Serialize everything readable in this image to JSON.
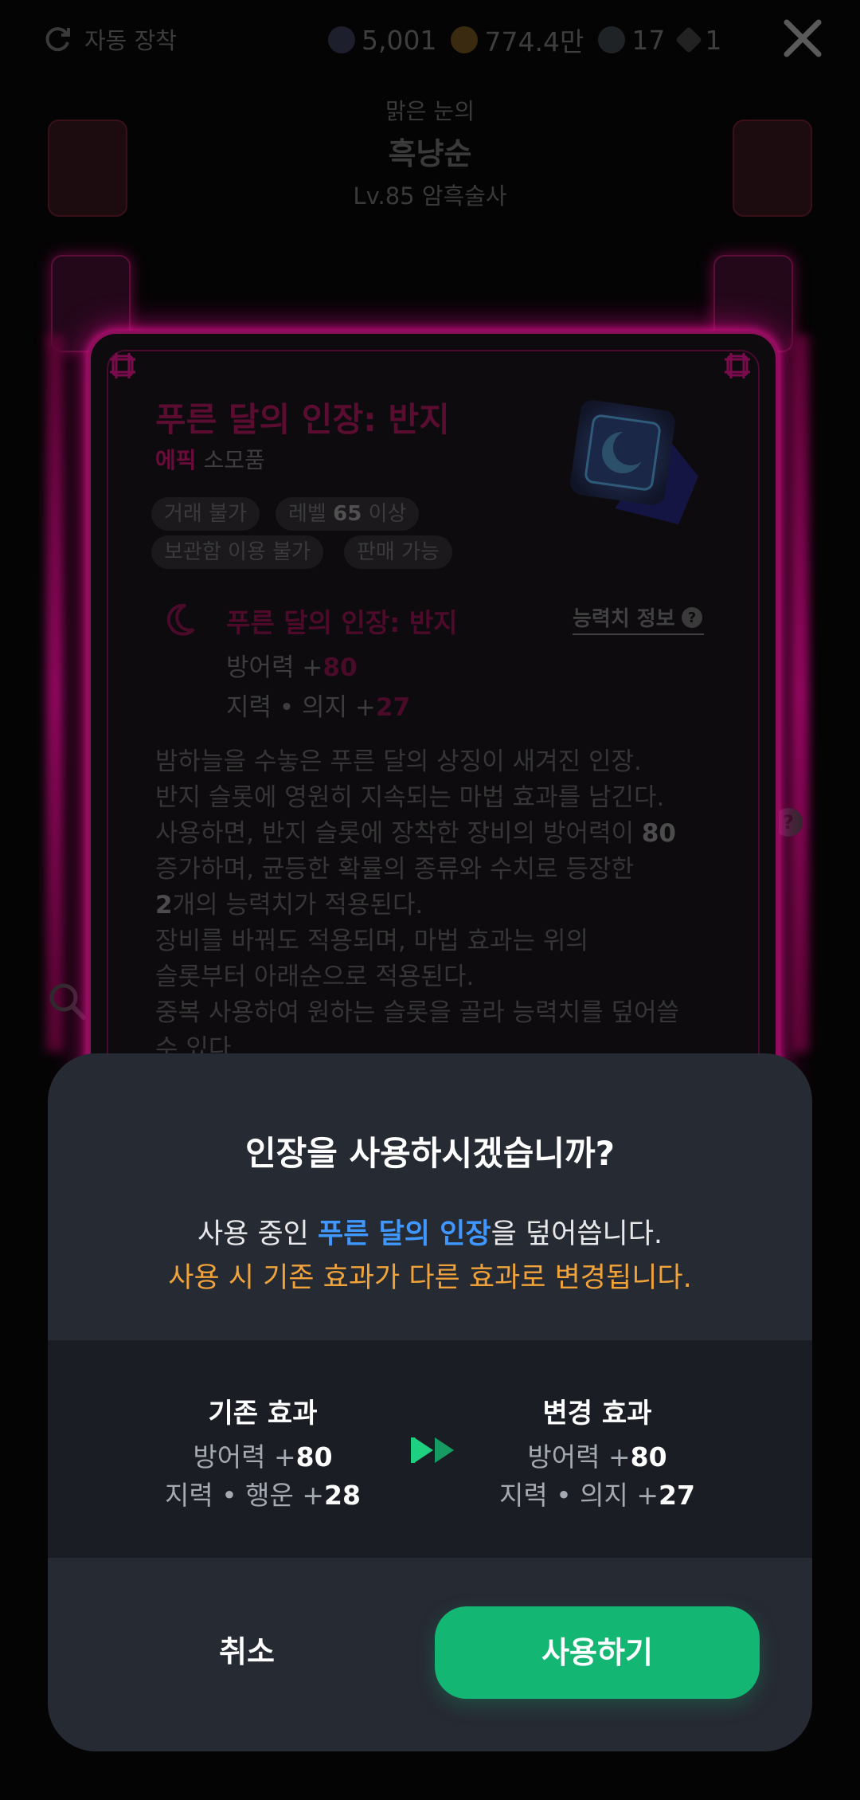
{
  "topbar": {
    "auto_equip_label": "자동 장착",
    "currencies": [
      {
        "icon": "dark-gem-icon",
        "value": "5,001"
      },
      {
        "icon": "gold-coin-icon",
        "value": "774.4만"
      },
      {
        "icon": "crystal-icon",
        "value": "17"
      },
      {
        "icon": "diamond-icon",
        "value": "1"
      }
    ]
  },
  "character": {
    "epithet": "맑은 눈의",
    "name": "흑냥순",
    "level_class": "Lv.85 암흑술사"
  },
  "item": {
    "name": "푸른 달의 인장: 반지",
    "grade": "에픽",
    "category": "소모품",
    "tags": [
      "거래 불가",
      "보관함 이용 불가",
      "판매 가능"
    ],
    "level_tag_prefix": "레벨",
    "level_tag_value": "65",
    "level_tag_suffix": "이상",
    "effect_title": "푸른 달의 인장: 반지",
    "stat_info_label": "능력치 정보",
    "effects": [
      {
        "label": "방어력 +",
        "value": "80"
      },
      {
        "label": "지력 • 의지 +",
        "value": "27"
      }
    ],
    "description": {
      "l1": "밤하늘을 수놓은 푸른 달의 상징이 새겨진 인장.",
      "l2": "반지 슬롯에 영원히 지속되는 마법 효과를 남긴다.",
      "l3a": "사용하면, 반지 슬롯에 장착한 장비의 방어력이 ",
      "l3b": "80",
      "l4": "증가하며, 균등한 확률의 종류와 수치로 등장한",
      "l5a": "2",
      "l5b": "개의 능력치가 적용된다.",
      "l6": "장비를 바꿔도 적용되며, 마법 효과는 위의",
      "l7": "슬롯부터 아래순으로 적용된다.",
      "l8": "중복 사용하여 원하는 슬롯을 골라 능력치를 덮어쓸",
      "l9": "수 있다."
    }
  },
  "modal": {
    "title": "인장을 사용하시겠습니까?",
    "msg_prefix": "사용 중인 ",
    "msg_highlight": "푸른 달의 인장",
    "msg_suffix": "을 덮어씁니다.",
    "warning": "사용 시 기존 효과가 다른 효과로 변경됩니다.",
    "old_title": "기존 효과",
    "old_effects": [
      {
        "label": "방어력 +",
        "value": "80"
      },
      {
        "label": "지력 • 행운 +",
        "value": "28"
      }
    ],
    "new_title": "변경 효과",
    "new_effects": [
      {
        "label": "방어력 +",
        "value": "80"
      },
      {
        "label": "지력 • 의지 +",
        "value": "27"
      }
    ],
    "cancel_label": "취소",
    "confirm_label": "사용하기",
    "colors": {
      "confirm": "#13b773",
      "highlight": "#3f97ff",
      "warning": "#f1a33a"
    }
  }
}
